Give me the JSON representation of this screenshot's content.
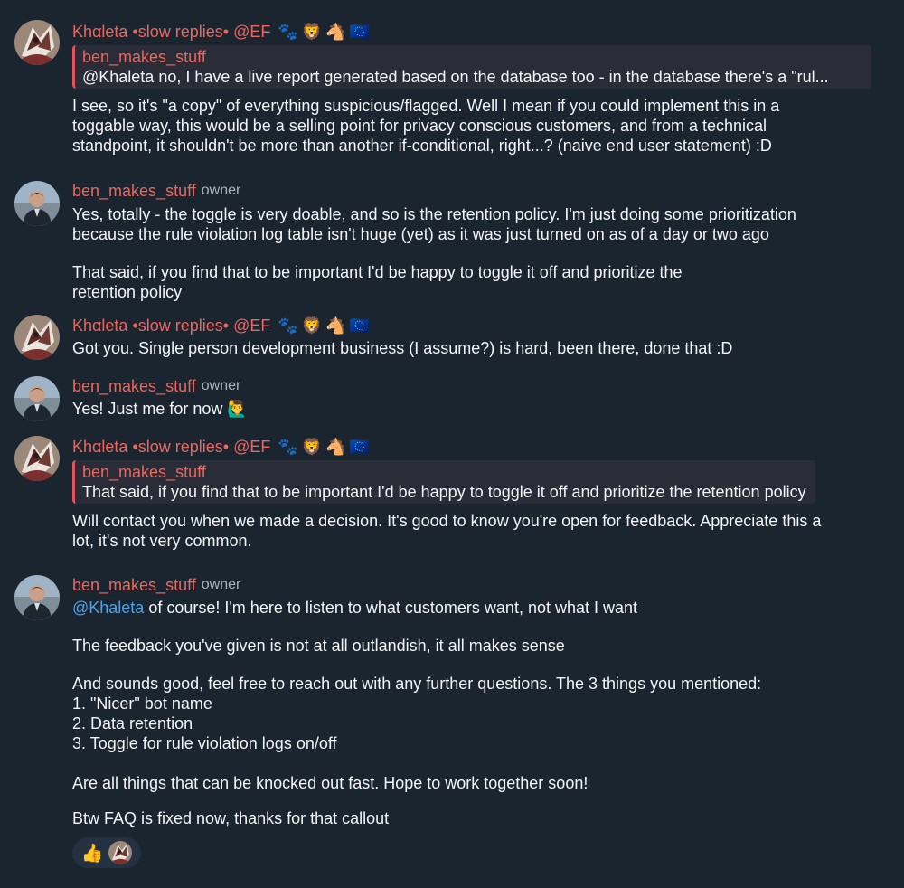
{
  "users": {
    "khaleta": {
      "name": "Khαleta •slow replies• @EF",
      "badges": [
        "🐾",
        "🦁",
        "🐴",
        "🇪🇺"
      ]
    },
    "ben": {
      "name": "ben_makes_stuff",
      "role": "owner"
    }
  },
  "messages": [
    {
      "reply": {
        "name": "ben_makes_stuff",
        "text": "@Khaleta no, I have a live report generated based on the database too - in the database there's a \"rul..."
      },
      "lines": [
        "I see, so it's \"a copy\" of everything suspicious/flagged. Well I mean if you could implement this in a",
        "toggable way, this would be a selling point for privacy conscious customers, and from a technical",
        "standpoint, it shouldn't be more than another if-conditional, right...? (naive end user statement) :D"
      ]
    },
    {
      "para1": [
        "Yes, totally - the toggle is very doable, and so is the retention policy. I'm just doing some prioritization",
        "because the rule violation log table isn't huge (yet) as it was just turned on as of a day or two ago"
      ],
      "para2": [
        "That said, if you find that to be important I'd be happy to toggle it off and prioritize the",
        "retention policy"
      ]
    },
    {
      "text": "Got you. Single person development business (I assume?) is hard, been there, done that :D"
    },
    {
      "text": "Yes! Just me for now 🙋‍♂️"
    },
    {
      "reply": {
        "name": "ben_makes_stuff",
        "text": "That said, if you find that to be important I'd be happy to toggle it off and prioritize the retention policy"
      },
      "lines": [
        "Will contact you when we made a decision. It's good to know you're open for feedback. Appreciate this a",
        "lot, it's not very common."
      ]
    },
    {
      "mention": "@Khaleta",
      "line1_rest": " of course! I'm here to listen to what customers want, not what I want",
      "line2": "The feedback you've given is not at all outlandish, it all makes sense",
      "list_intro": "And sounds good, feel free to reach out with any further questions. The 3 things you mentioned:",
      "list": [
        "1. \"Nicer\" bot name",
        "2. Data retention",
        "3. Toggle for rule violation logs on/off"
      ],
      "line3": "Are all things that can be knocked out fast. Hope to work together soon!",
      "line4": "Btw FAQ is fixed now, thanks for that callout",
      "reactions": [
        {
          "emoji": "👍"
        },
        {
          "emoji": "custom-avatar"
        }
      ]
    }
  ]
}
